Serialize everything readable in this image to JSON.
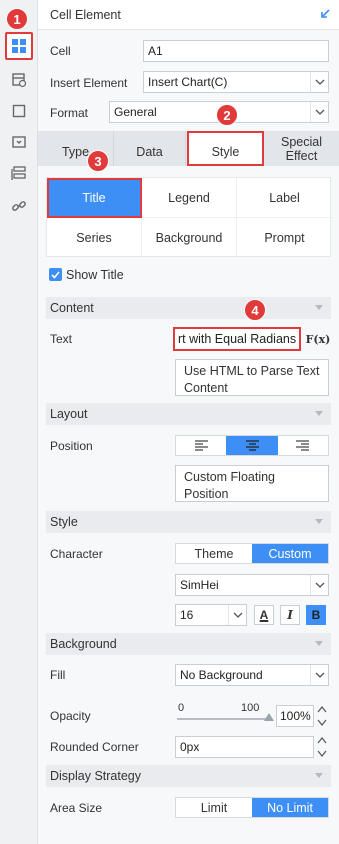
{
  "panel": {
    "title": "Cell Element"
  },
  "badges": [
    "1",
    "2",
    "3",
    "4"
  ],
  "fields": {
    "cell_label": "Cell",
    "cell_value": "A1",
    "insert_label": "Insert Element",
    "insert_value": "Insert Chart(C)",
    "format_label": "Format",
    "format_value": "General"
  },
  "tabs": [
    "Type",
    "Data",
    "Style",
    "Special Effect"
  ],
  "style_grid": [
    "Title",
    "Legend",
    "Label",
    "Series",
    "Background",
    "Prompt"
  ],
  "show_title": {
    "label": "Show Title",
    "checked": true
  },
  "content": {
    "section": "Content",
    "text_label": "Text",
    "text_value": "rt with Equal Radians",
    "formula_icon": "F(x)",
    "html_parse": "Use HTML to Parse Text Content"
  },
  "layout": {
    "section": "Layout",
    "position_label": "Position",
    "align_options": [
      "left-align-icon",
      "center-align-icon",
      "right-align-icon"
    ],
    "align_selected": "center-align-icon",
    "floating": "Custom Floating Position"
  },
  "style": {
    "section": "Style",
    "character_label": "Character",
    "theme_opts": [
      "Theme",
      "Custom"
    ],
    "theme_selected": "Custom",
    "font": "SimHei",
    "size": "16",
    "bold_label": "B",
    "italic_label": "I",
    "color_label": "A"
  },
  "background": {
    "section": "Background",
    "fill_label": "Fill",
    "fill_value": "No Background",
    "opacity_label": "Opacity",
    "opacity_min": "0",
    "opacity_max": "100",
    "opacity_value": "100%",
    "opacity_level": 1.0,
    "corner_label": "Rounded Corner",
    "corner_value": "0px"
  },
  "display": {
    "section": "Display Strategy",
    "area_label": "Area Size",
    "opts": [
      "Limit",
      "No Limit"
    ],
    "selected": "No Limit"
  },
  "colors": {
    "accent": "#3d8ef5",
    "highlight": "#e03a3a"
  }
}
